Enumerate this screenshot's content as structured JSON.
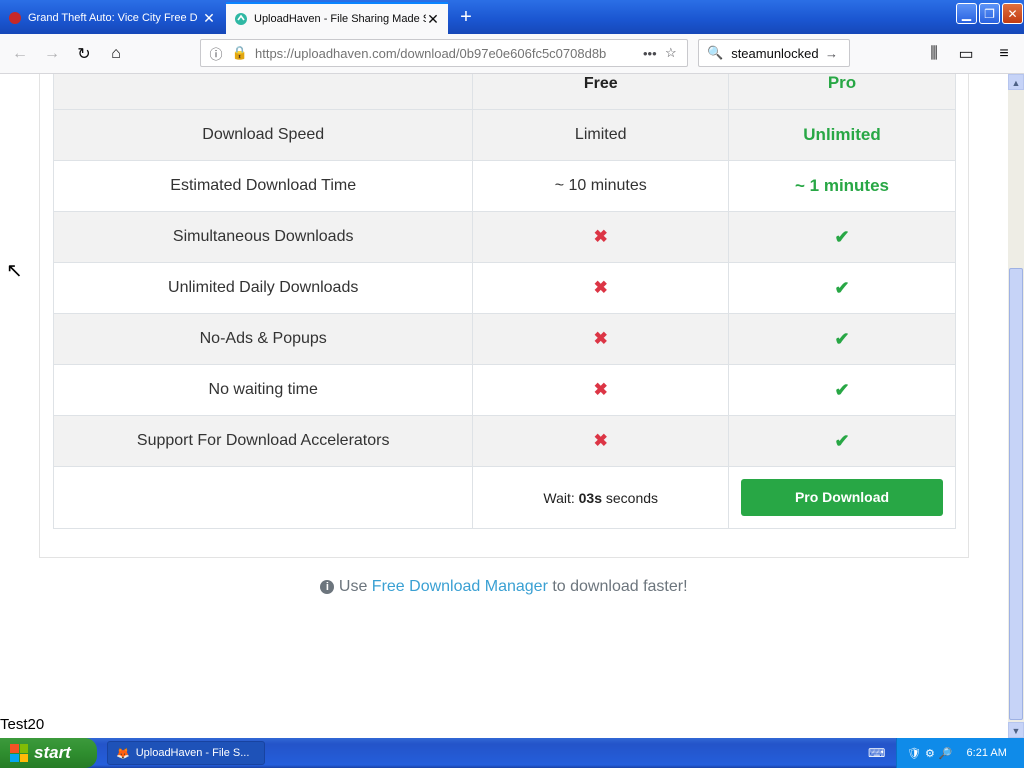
{
  "browser": {
    "tabs": [
      {
        "title": "Grand Theft Auto: Vice City Free D",
        "active": false
      },
      {
        "title": "UploadHaven - File Sharing Made S",
        "active": true
      }
    ],
    "url": "https://uploadhaven.com/download/0b97e0e606fc5c0708d8b",
    "search_text": "steamunlocked"
  },
  "colors": {
    "accent": "#28a745",
    "danger": "#dc3545",
    "link": "#3aa0d3"
  },
  "table": {
    "headers": [
      "",
      "Free",
      "Pro"
    ],
    "rows": [
      {
        "feature": "Download Speed",
        "free": "Limited",
        "pro": "Unlimited"
      },
      {
        "feature": "Estimated Download Time",
        "free": "~ 10 minutes",
        "pro": "~ 1 minutes"
      },
      {
        "feature": "Simultaneous Downloads",
        "free": "✖",
        "pro": "✔"
      },
      {
        "feature": "Unlimited Daily Downloads",
        "free": "✖",
        "pro": "✔"
      },
      {
        "feature": "No-Ads & Popups",
        "free": "✖",
        "pro": "✔"
      },
      {
        "feature": "No waiting time",
        "free": "✖",
        "pro": "✔"
      },
      {
        "feature": "Support For Download Accelerators",
        "free": "✖",
        "pro": "✔"
      }
    ],
    "wait_prefix": "Wait:",
    "wait_value": "03s",
    "wait_suffix": "seconds",
    "pro_button": "Pro Download"
  },
  "footer": {
    "prefix": "Use",
    "link": "Free Download Manager",
    "suffix": "to download faster!"
  },
  "stray_text": "Test20",
  "taskbar": {
    "start": "start",
    "task": "UploadHaven - File S...",
    "clock": "6:21 AM"
  }
}
